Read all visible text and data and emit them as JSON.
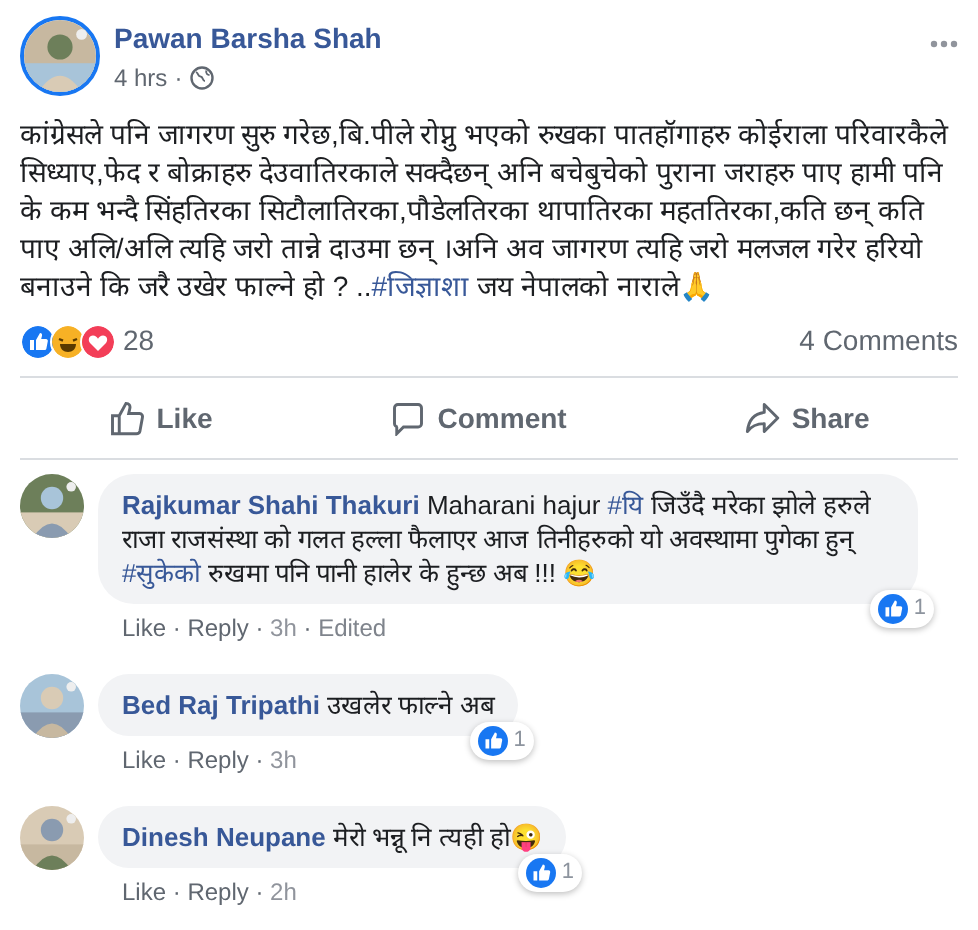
{
  "post": {
    "author": "Pawan Barsha Shah",
    "time": "4 hrs",
    "separator": "·",
    "text": [
      {
        "kind": "text",
        "text": "कांग्रेसले पनि जागरण सुरु गरेछ,बि.पीले रोप्नु भएको रुखका पातहॉगाहरु कोईराला परिवारकैले सिध्याए,फेद र बोक्राहरु देउवातिरकाले सक्दैछन् अनि बचेबुचेको पुराना जराहरु पाए हामी पनि के कम भन्दै सिंहतिरका सिटौलातिरका,पौडेलतिरका थापातिरका महततिरका,कति छन् कति पाए अलि/अलि त्यहि जरो तान्ने दाउमा छन् ।अनि अव जागरण त्यहि जरो मलजल गरेर हरियो बनाउने कि जरै उखेर फाल्ने हो ? .."
      },
      {
        "kind": "hashtag",
        "text": "#जिज्ञाशा"
      },
      {
        "kind": "text",
        "text": " जय नेपालको नाराले🙏"
      }
    ],
    "reactions": {
      "count": "28"
    },
    "comments_count": "4 Comments",
    "actions": [
      {
        "kind": "like",
        "label": "Like"
      },
      {
        "kind": "comment",
        "label": "Comment"
      },
      {
        "kind": "share",
        "label": "Share"
      }
    ]
  },
  "comments": [
    {
      "author": "Rajkumar Shahi Thakuri",
      "text": [
        {
          "kind": "text",
          "text": "Maharani hajur "
        },
        {
          "kind": "hashtag",
          "text": "#यि"
        },
        {
          "kind": "text",
          "text": " जिउँदै मरेका झोले हरुले राजा राजसंस्था को गलत हल्ला फैलाएर आज तिनीहरुको यो अवस्थामा पुगेका हुन् "
        },
        {
          "kind": "hashtag",
          "text": "#सुकेको"
        },
        {
          "kind": "text",
          "text": " रुखमा पनि पानी हालेर के हुन्छ अब !!! 😂"
        }
      ],
      "reaction_count": "1",
      "meta": [
        {
          "kind": "link",
          "text": "Like"
        },
        {
          "kind": "link",
          "text": "Reply"
        },
        {
          "kind": "time",
          "text": "3h"
        },
        {
          "kind": "note",
          "text": "Edited"
        }
      ]
    },
    {
      "author": "Bed Raj Tripathi",
      "text": [
        {
          "kind": "text",
          "text": "उखलेर फाल्ने अब"
        }
      ],
      "reaction_count": "1",
      "meta": [
        {
          "kind": "link",
          "text": "Like"
        },
        {
          "kind": "link",
          "text": "Reply"
        },
        {
          "kind": "time",
          "text": "3h"
        }
      ]
    },
    {
      "author": "Dinesh Neupane",
      "text": [
        {
          "kind": "text",
          "text": "मेरो भन्नू नि त्यही हो😜"
        }
      ],
      "reaction_count": "1",
      "meta": [
        {
          "kind": "link",
          "text": "Like"
        },
        {
          "kind": "link",
          "text": "Reply"
        },
        {
          "kind": "time",
          "text": "2h"
        }
      ]
    }
  ]
}
